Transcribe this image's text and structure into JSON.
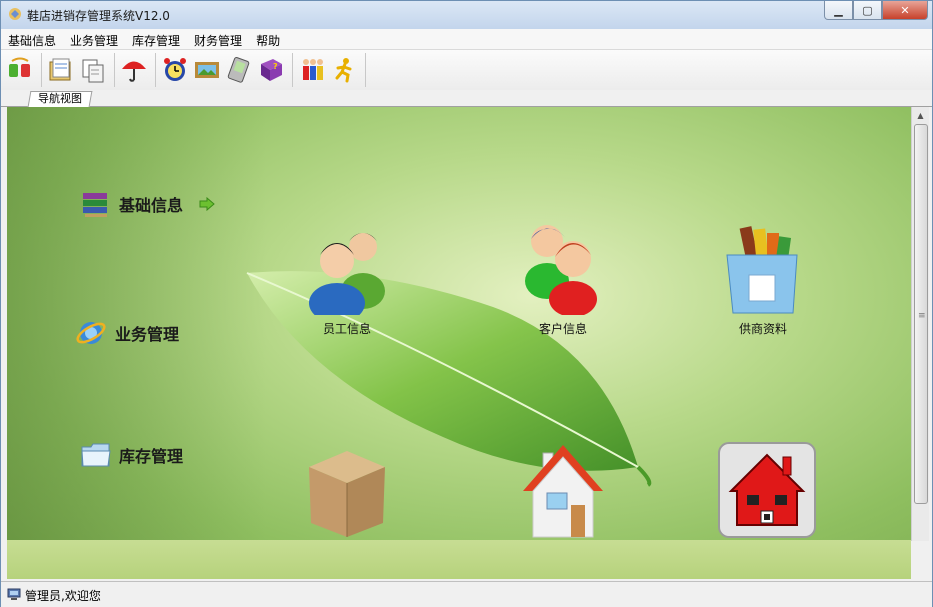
{
  "window": {
    "title": "鞋店进销存管理系统V12.0",
    "controls": {
      "minimize": "▁",
      "maximize": "▢",
      "close": "✕"
    }
  },
  "menu": [
    "基础信息",
    "业务管理",
    "库存管理",
    "财务管理",
    "帮助"
  ],
  "toolbar": {
    "icons": [
      "sync-icon",
      "folder-icon",
      "documents-icon",
      "umbrella-icon",
      "alarm-clock-icon",
      "picture-icon",
      "pda-icon",
      "help-book-icon",
      "users-icon",
      "running-man-icon"
    ]
  },
  "tab": {
    "label": "导航视图"
  },
  "nav": [
    {
      "label": "基础信息",
      "icon": "books-icon",
      "arrow": "arrow-right-icon"
    },
    {
      "label": "业务管理",
      "icon": "ie-globe-icon"
    },
    {
      "label": "库存管理",
      "icon": "folder-open-icon"
    }
  ],
  "modules": [
    {
      "label": "员工信息",
      "icon": "employees-icon"
    },
    {
      "label": "客户信息",
      "icon": "customers-icon"
    },
    {
      "label": "供商资料",
      "icon": "supplier-box-icon"
    },
    {
      "label": "",
      "icon": "cardboard-box-icon"
    },
    {
      "label": "",
      "icon": "house-icon"
    },
    {
      "label": "",
      "icon": "red-house-icon"
    }
  ],
  "status": {
    "text": "管理员,欢迎您"
  },
  "colors": {
    "accent_green": "#8fbf60",
    "title_bg": "#c3d5ec",
    "close_red": "#c7412b"
  }
}
